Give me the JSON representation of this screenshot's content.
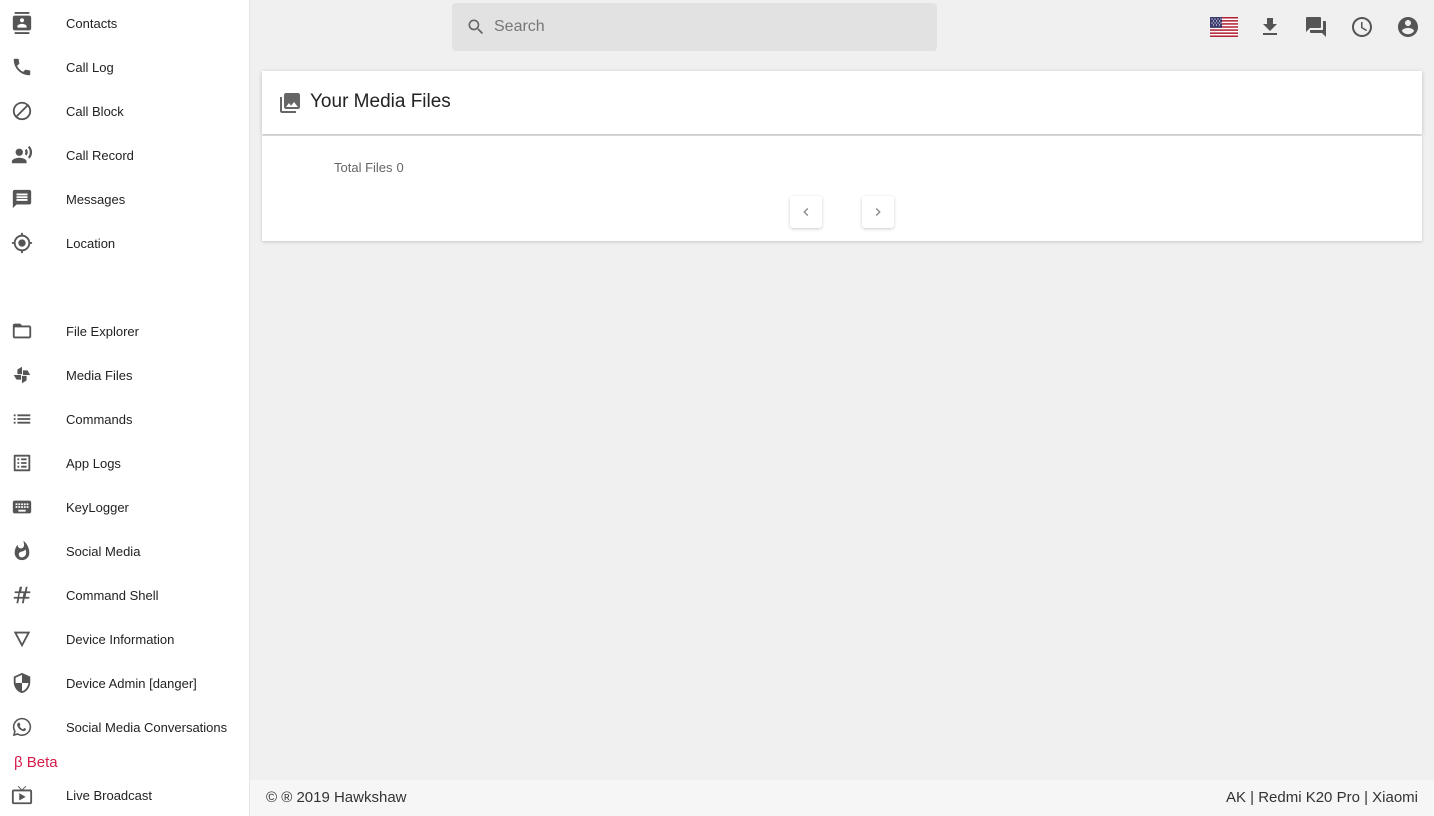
{
  "sidebar": {
    "items": [
      {
        "label": "Contacts",
        "icon": "contacts-icon"
      },
      {
        "label": "Call Log",
        "icon": "phone-icon"
      },
      {
        "label": "Call Block",
        "icon": "block-icon"
      },
      {
        "label": "Call Record",
        "icon": "record-voice-icon"
      },
      {
        "label": "Messages",
        "icon": "message-icon"
      },
      {
        "label": "Location",
        "icon": "location-icon"
      },
      {
        "label": "File Explorer",
        "icon": "folder-icon"
      },
      {
        "label": "Media Files",
        "icon": "pinwheel-icon"
      },
      {
        "label": "Commands",
        "icon": "list-icon"
      },
      {
        "label": "App Logs",
        "icon": "list-box-icon"
      },
      {
        "label": "KeyLogger",
        "icon": "keyboard-icon"
      },
      {
        "label": "Social Media",
        "icon": "flame-icon"
      },
      {
        "label": "Command Shell",
        "icon": "hash-icon"
      },
      {
        "label": "Device Information",
        "icon": "triangle-icon"
      },
      {
        "label": "Device Admin [danger]",
        "icon": "shield-icon"
      },
      {
        "label": "Social Media Conversations",
        "icon": "whatsapp-icon"
      }
    ],
    "beta_label": "β Beta",
    "beta_items": [
      {
        "label": "Live Broadcast",
        "icon": "live-tv-icon"
      }
    ]
  },
  "topbar": {
    "search_placeholder": "Search",
    "search_value": "",
    "icons": [
      "us-flag-icon",
      "download-icon",
      "forum-icon",
      "clock-icon",
      "account-icon"
    ]
  },
  "main": {
    "title": "Your Media Files",
    "title_icon": "photo-library-icon",
    "total_files_label": "Total Files",
    "total_files_count": "0",
    "prev_icon": "chevron-left-icon",
    "next_icon": "chevron-right-icon"
  },
  "footer": {
    "copyright": "© ® 2019 Hawkshaw",
    "device": "AK | Redmi K20 Pro | Xiaomi"
  },
  "colors": {
    "background": "#f0f0f0",
    "beta_accent": "#d81b4a",
    "icon_gray": "#555555"
  }
}
